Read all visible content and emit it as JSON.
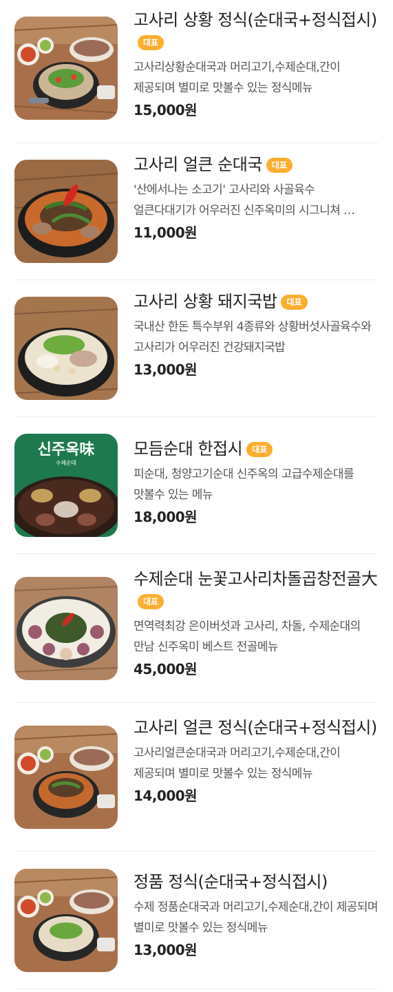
{
  "menu": {
    "items": [
      {
        "name": "고사리 상황 정식(순대국+정식접시)",
        "badge": "대표",
        "description": "고사리상황순대국과 머리고기,수제순대,간이 제공되며 별미로 맛볼수 있는 정식메뉴",
        "price": "15,000원"
      },
      {
        "name": "고사리 얼큰 순대국",
        "badge": "대표",
        "description": "'산에서나는 소고기' 고사리와 사골육수 얼큰다대기가 어우러진 신주옥미의 시그니쳐 …",
        "price": "11,000원"
      },
      {
        "name": "고사리 상황 돼지국밥",
        "badge": "대표",
        "description": "국내산 한돈 특수부위 4종류와 상황버섯사골육수와 고사리가 어우러진 건강돼지국밥",
        "price": "13,000원"
      },
      {
        "name": "모듬순대 한접시",
        "badge": "대표",
        "description": "피순대, 청양고기순대 신주옥의 고급수제순대를 맛볼수 있는 메뉴",
        "price": "18,000원",
        "image_text": {
          "brand": "신주옥味",
          "caption": "수제순대"
        }
      },
      {
        "name": "수제순대 눈꽃고사리차돌곱창전골大",
        "badge": "대표",
        "description": "면역력최강 은이버섯과 고사리, 차돌, 수제순대의 만남 신주옥미 베스트 전골메뉴",
        "price": "45,000원"
      },
      {
        "name": "고사리 얼큰 정식(순대국+정식접시)",
        "badge": "",
        "description": "고사리얼큰순대국과 머리고기,수제순대,간이 제공되며 별미로 맛볼수 있는 정식메뉴",
        "price": "14,000원"
      },
      {
        "name": "정품 정식(순대국+정식접시)",
        "badge": "",
        "description": "수제 정품순대국과 머리고기,수제순대,간이 제공되며 별미로 맛볼수 있는 정식메뉴",
        "price": "13,000원"
      }
    ]
  },
  "colors": {
    "badge": "#ffad2f",
    "text": "#222222",
    "description": "#555555",
    "divider": "#ececec"
  }
}
